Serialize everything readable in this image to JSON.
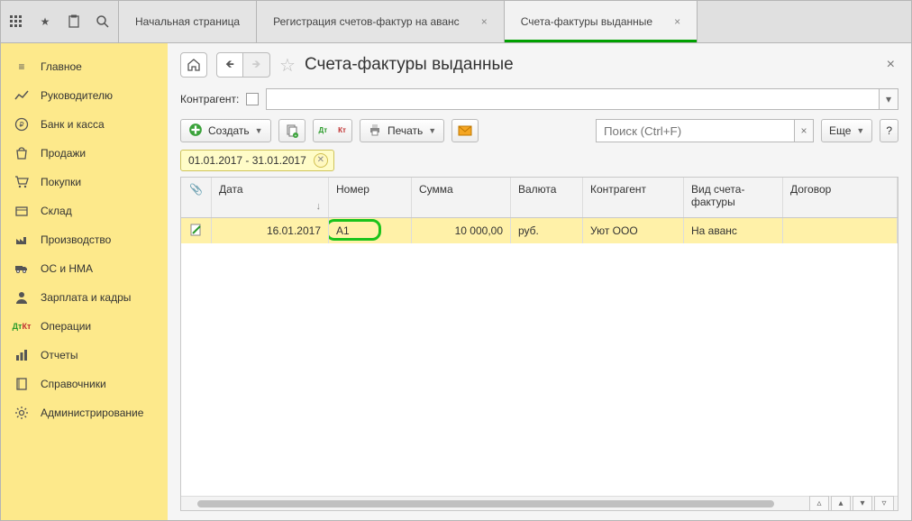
{
  "top_tabs": [
    "Начальная страница",
    "Регистрация счетов-фактур на аванс",
    "Счета-фактуры выданные"
  ],
  "active_tab_index": 2,
  "sidebar": [
    {
      "icon": "menu",
      "label": "Главное"
    },
    {
      "icon": "chart",
      "label": "Руководителю"
    },
    {
      "icon": "ruble",
      "label": "Банк и касса"
    },
    {
      "icon": "bag",
      "label": "Продажи"
    },
    {
      "icon": "cart",
      "label": "Покупки"
    },
    {
      "icon": "box",
      "label": "Склад"
    },
    {
      "icon": "factory",
      "label": "Производство"
    },
    {
      "icon": "truck",
      "label": "ОС и НМА"
    },
    {
      "icon": "person",
      "label": "Зарплата и кадры"
    },
    {
      "icon": "dtkt",
      "label": "Операции"
    },
    {
      "icon": "bars",
      "label": "Отчеты"
    },
    {
      "icon": "book",
      "label": "Справочники"
    },
    {
      "icon": "gear",
      "label": "Администрирование"
    }
  ],
  "page": {
    "title": "Счета-фактуры выданные",
    "filter_label": "Контрагент:",
    "create_label": "Создать",
    "print_label": "Печать",
    "search_placeholder": "Поиск (Ctrl+F)",
    "more_label": "Еще",
    "help_label": "?",
    "date_filter": "01.01.2017 - 31.01.2017"
  },
  "columns": [
    "",
    "Дата",
    "Номер",
    "Сумма",
    "Валюта",
    "Контрагент",
    "Вид счета-фактуры",
    "Договор"
  ],
  "rows": [
    {
      "date": "16.01.2017",
      "number": "А1",
      "sum": "10 000,00",
      "currency": "руб.",
      "partner": "Уют ООО",
      "kind": "На аванс",
      "contract": ""
    }
  ]
}
